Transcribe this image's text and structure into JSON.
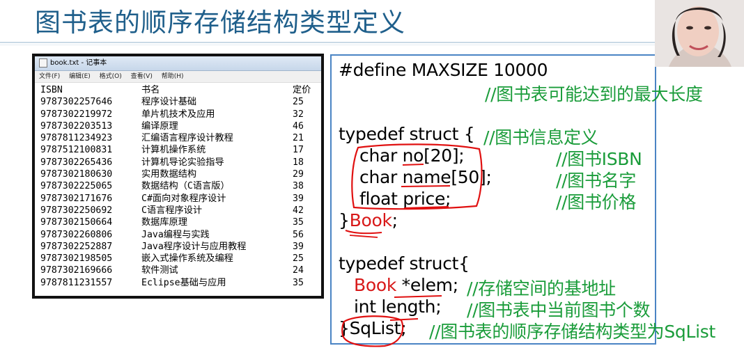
{
  "slide": {
    "title": "图书表的顺序存储结构类型定义"
  },
  "notepad": {
    "window_title": "book.txt - 记事本",
    "menu": [
      "文件(F)",
      "编辑(E)",
      "格式(O)",
      "查看(V)",
      "帮助(H)"
    ],
    "headers": [
      "ISBN",
      "书名",
      "定价"
    ],
    "rows": [
      [
        "9787302257646",
        "程序设计基础",
        "25"
      ],
      [
        "9787302219972",
        "单片机技术及应用",
        "32"
      ],
      [
        "9787302203513",
        "编译原理",
        "46"
      ],
      [
        "9787811234923",
        "汇编语言程序设计教程",
        "21"
      ],
      [
        "9787512100831",
        "计算机操作系统",
        "17"
      ],
      [
        "9787302265436",
        "计算机导论实验指导",
        "18"
      ],
      [
        "9787302180630",
        "实用数据结构",
        "29"
      ],
      [
        "9787302225065",
        "数据结构（C语言版）",
        "38"
      ],
      [
        "9787302171676",
        "C#面向对象程序设计",
        "39"
      ],
      [
        "9787302250692",
        "C语言程序设计",
        "42"
      ],
      [
        "9787302150664",
        "数据库原理",
        "35"
      ],
      [
        "9787302260806",
        "Java编程与实践",
        "56"
      ],
      [
        "9787302252887",
        "Java程序设计与应用教程",
        "39"
      ],
      [
        "9787302198505",
        "嵌入式操作系统及编程",
        "25"
      ],
      [
        "9787302169666",
        "软件测试",
        "24"
      ],
      [
        "9787811231557",
        "Eclipse基础与应用",
        "35"
      ]
    ]
  },
  "code": {
    "define_line": "#define MAXSIZE 10000",
    "define_comment": "//图书表可能达到的最大长度",
    "typedef1_open": "typedef struct   {",
    "typedef1_comment": "//图书信息定义",
    "field_no": "char no[20];",
    "field_no_comment": "//图书ISBN",
    "field_name": "char name[50];",
    "field_name_comment": "//图书名字",
    "field_price": "float price;",
    "field_price_comment": "//图书价格",
    "close_brace1": "}",
    "book_type": "Book",
    "semicolon1": ";",
    "typedef2_open": "typedef struct{",
    "elem_type": "Book",
    "elem_rest": " *elem;",
    "elem_comment": "//存储空间的基地址",
    "length_field": "int length;",
    "length_comment": "//图书表中当前图书个数",
    "close_brace2": "}SqList;",
    "sqlist_comment": "//图书表的顺序存储结构类型为SqList"
  },
  "colors": {
    "title": "#1f5f8b",
    "comment": "#1a9c3a",
    "highlight": "#d81818",
    "box_border": "#4a84c4"
  }
}
